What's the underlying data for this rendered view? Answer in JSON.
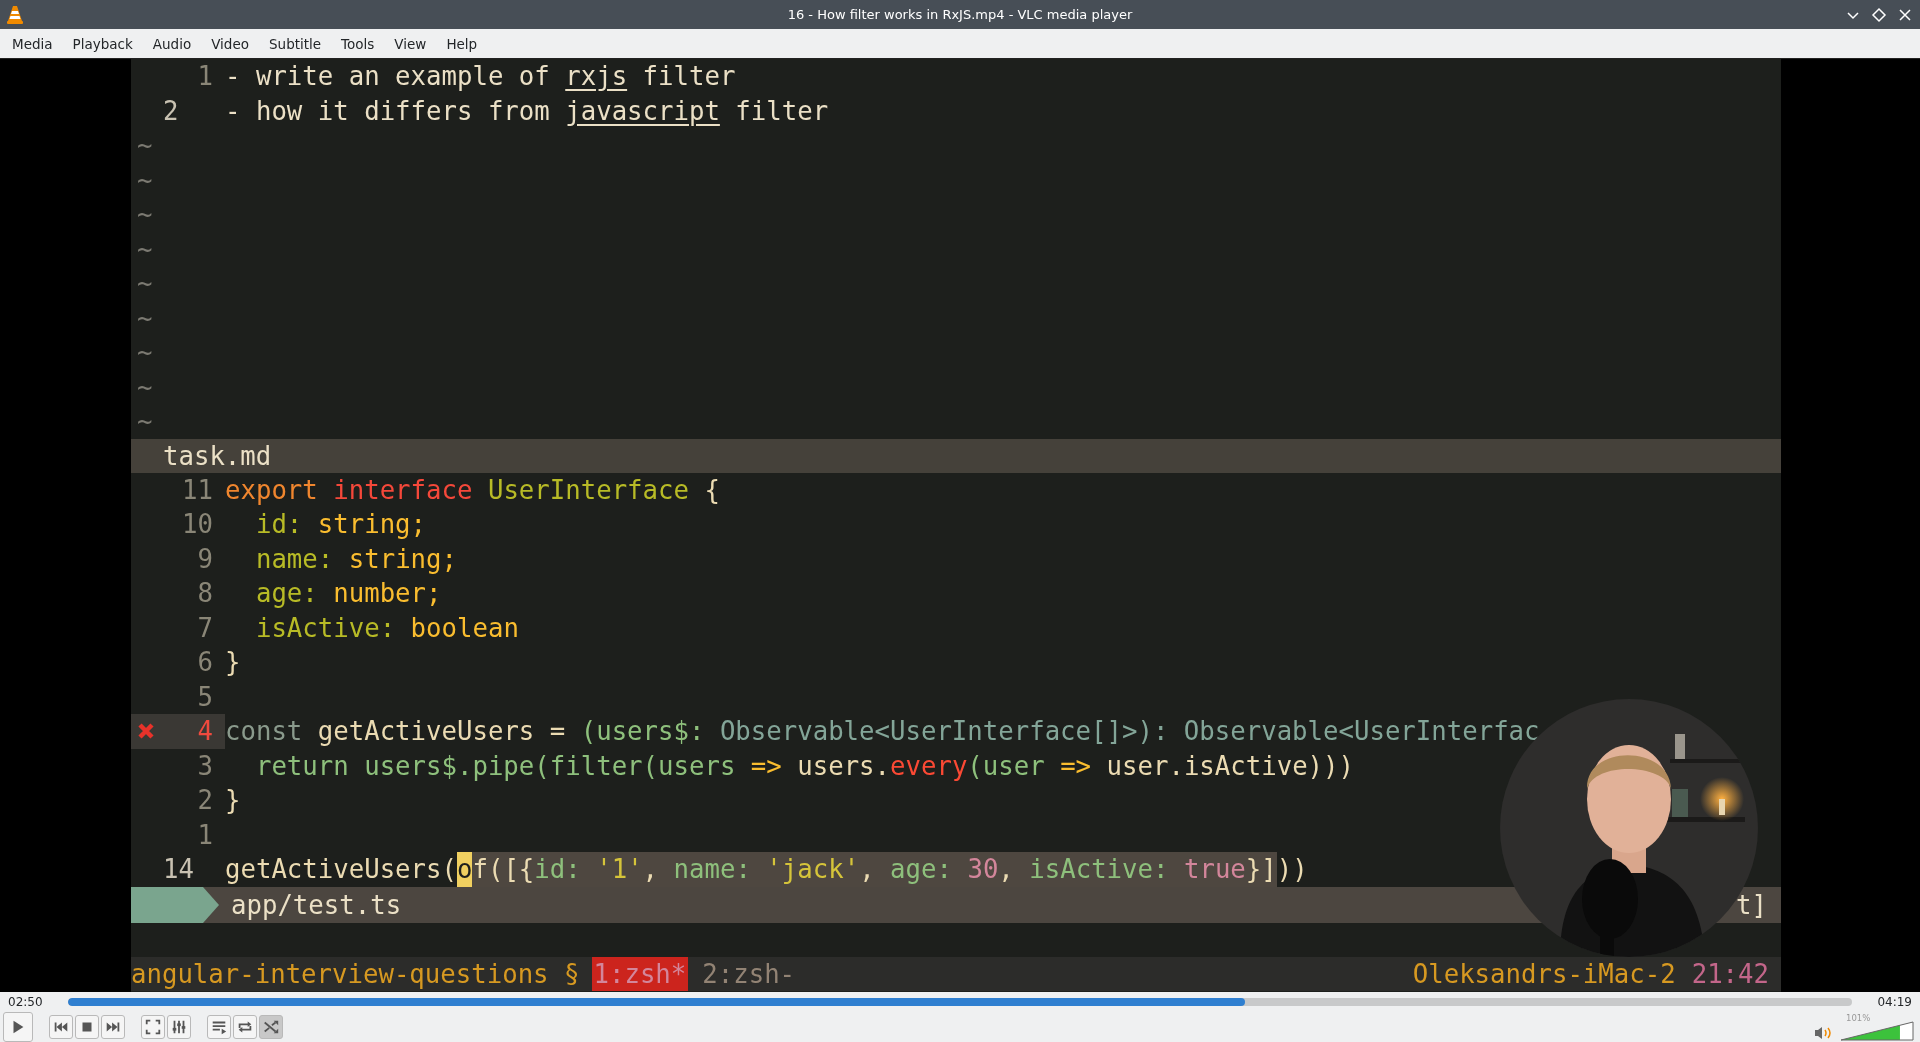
{
  "window": {
    "title": "16 - How filter works in RxJS.mp4 - VLC media player"
  },
  "menu": [
    "Media",
    "Playback",
    "Audio",
    "Video",
    "Subtitle",
    "Tools",
    "View",
    "Help"
  ],
  "video": {
    "top_pane": {
      "lines": [
        {
          "number": "1",
          "current": false,
          "segments": [
            {
              "text": "- write an example of ",
              "underlined": false
            },
            {
              "text": "rxjs",
              "underlined": true
            },
            {
              "text": " filter",
              "underlined": false
            }
          ]
        },
        {
          "number": "2",
          "current": true,
          "segments": [
            {
              "text": "- how it differs from ",
              "underlined": false
            },
            {
              "text": "javascript",
              "underlined": true
            },
            {
              "text": " filter",
              "underlined": false
            }
          ]
        }
      ],
      "tildes": [
        "~",
        "~",
        "~",
        "~",
        "~",
        "~",
        "~",
        "~",
        "~"
      ]
    },
    "pane_title": "task.md",
    "lower_pane": {
      "lines": [
        {
          "number": "11",
          "current": false,
          "error": false,
          "segments": [
            {
              "text": "export",
              "color": "#f0862e"
            },
            {
              "text": " interface",
              "color": "#f5483a"
            },
            {
              "text": " UserInterface",
              "color": "#b8bb26"
            },
            {
              "text": " {",
              "color": "#ebdbb2"
            }
          ]
        },
        {
          "number": "10",
          "current": false,
          "error": false,
          "segments": [
            {
              "text": "  id:",
              "color": "#b8bb26"
            },
            {
              "text": " string;",
              "color": "#fabd2f"
            }
          ]
        },
        {
          "number": "9",
          "current": false,
          "error": false,
          "segments": [
            {
              "text": "  name:",
              "color": "#b8bb26"
            },
            {
              "text": " string;",
              "color": "#fabd2f"
            }
          ]
        },
        {
          "number": "8",
          "current": false,
          "error": false,
          "segments": [
            {
              "text": "  age:",
              "color": "#b8bb26"
            },
            {
              "text": " number;",
              "color": "#fabd2f"
            }
          ]
        },
        {
          "number": "7",
          "current": false,
          "error": false,
          "segments": [
            {
              "text": "  isActive:",
              "color": "#b8bb26"
            },
            {
              "text": " boolean",
              "color": "#fabd2f"
            }
          ]
        },
        {
          "number": "6",
          "current": false,
          "error": false,
          "segments": [
            {
              "text": "}",
              "color": "#ebdbb2"
            }
          ]
        },
        {
          "number": "5",
          "current": false,
          "error": false
        },
        {
          "number": "4",
          "current": false,
          "error": true,
          "segments": [
            {
              "text": "const",
              "color": "#8a9a8c"
            },
            {
              "text": " getActiveUsers = ",
              "color": "#ebdbb2"
            },
            {
              "text": "(users$: ",
              "color": "#8ec07c"
            },
            {
              "text": "Observable<UserInterface[]>): Observable<UserInterfac",
              "color": "#83a598"
            }
          ]
        },
        {
          "number": "3",
          "current": false,
          "error": false,
          "segments": [
            {
              "text": "  return users$.pipe(filter(users",
              "color": "#8ec07c"
            },
            {
              "text": " => ",
              "color": "#fabd2f"
            },
            {
              "text": "users.",
              "color": "#ebdbb2"
            },
            {
              "text": "every",
              "color": "#fb4934"
            },
            {
              "text": "(user",
              "color": "#8ec07c"
            },
            {
              "text": " => ",
              "color": "#fabd2f"
            },
            {
              "text": "user.isActive)))",
              "color": "#ebdbb2"
            }
          ]
        },
        {
          "number": "2",
          "current": false,
          "error": false,
          "segments": [
            {
              "text": "}",
              "color": "#ebdbb2"
            }
          ]
        },
        {
          "number": "1",
          "current": false,
          "error": false
        },
        {
          "number": "14",
          "current": true,
          "error": false,
          "segments": [
            {
              "text": "getActiveUsers(",
              "color": "#ebdbb2",
              "kind": "plain"
            },
            {
              "text": "o",
              "kind": "cursor"
            },
            {
              "text": "f([{",
              "color": "#ebdbb2",
              "kind": "selected"
            },
            {
              "text": "id:",
              "color": "#8ec07c",
              "kind": "selected"
            },
            {
              "text": " '1'",
              "color": "#d5c43a",
              "kind": "selected"
            },
            {
              "text": ", ",
              "color": "#ebdbb2",
              "kind": "selected"
            },
            {
              "text": "name:",
              "color": "#8ec07c",
              "kind": "selected"
            },
            {
              "text": " 'jack'",
              "color": "#d5c43a",
              "kind": "selected"
            },
            {
              "text": ", ",
              "color": "#ebdbb2",
              "kind": "selected"
            },
            {
              "text": "age:",
              "color": "#8ec07c",
              "kind": "selected"
            },
            {
              "text": " 30",
              "color": "#d3869b",
              "kind": "selected"
            },
            {
              "text": ", ",
              "color": "#ebdbb2",
              "kind": "selected"
            },
            {
              "text": "isActive:",
              "color": "#8ec07c",
              "kind": "selected"
            },
            {
              "text": " true",
              "color": "#d3869b",
              "kind": "selected"
            },
            {
              "text": "}]",
              "color": "#ebdbb2",
              "kind": "selected"
            },
            {
              "text": "))",
              "color": "#ebdbb2",
              "kind": "plain"
            }
          ]
        }
      ]
    },
    "lower_status": {
      "file": "app/test.ts",
      "right_text": "t]"
    },
    "tmux": {
      "session": "angular-interview-questions §",
      "windows": [
        {
          "label": "1:zsh*",
          "selected": true
        },
        {
          "label": "2:zsh-",
          "selected": false
        }
      ],
      "host": "Oleksandrs-iMac-2",
      "time": "21:42"
    }
  },
  "controls": {
    "elapsed": "02:50",
    "total": "04:19",
    "progress": {
      "level": 0.66
    },
    "buttons": [
      {
        "kind": "play",
        "on": false
      },
      {
        "kind": "previous",
        "on": false
      },
      {
        "kind": "stop",
        "on": false
      },
      {
        "kind": "next",
        "on": false
      },
      {
        "kind": "fullscreen",
        "on": false
      },
      {
        "kind": "extended",
        "on": false
      },
      {
        "kind": "playlist",
        "on": false
      },
      {
        "kind": "loop",
        "on": false
      },
      {
        "kind": "shuffle",
        "on": true
      }
    ],
    "volume": {
      "label": "101%",
      "level": 0.81
    }
  }
}
